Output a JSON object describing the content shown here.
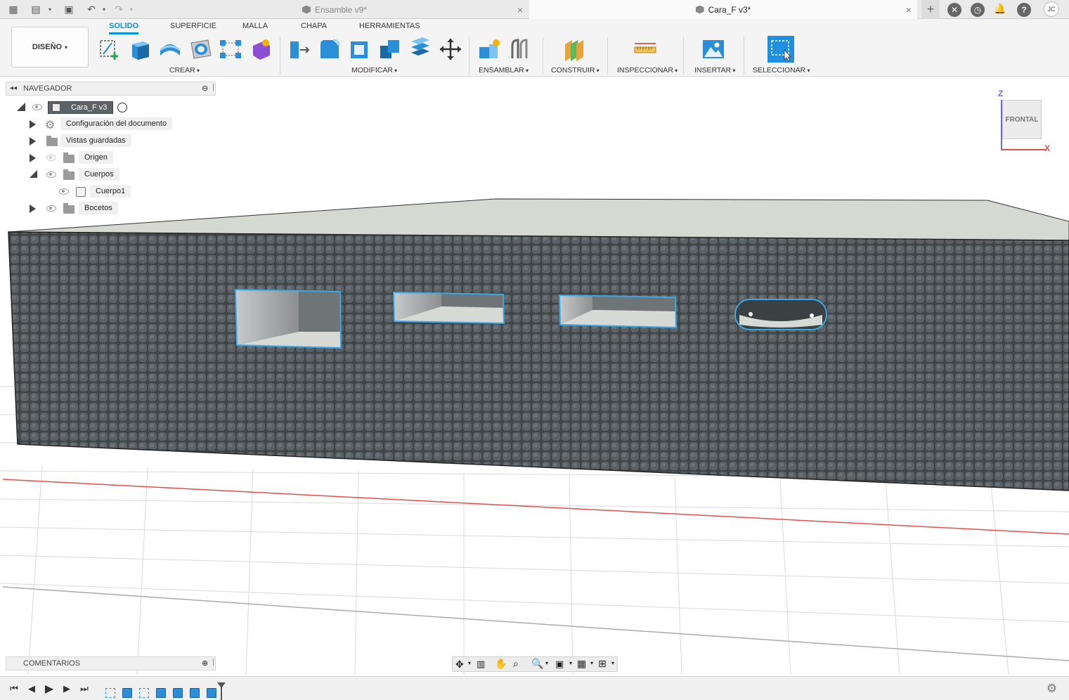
{
  "tabs": [
    {
      "label": "Ensamble v9*",
      "active": false
    },
    {
      "label": "Cara_F v3*",
      "active": true
    }
  ],
  "user_initials": "JC",
  "workspace": "DISEÑO",
  "ribbon_tabs": [
    "SOLIDO",
    "SUPERFICIE",
    "MALLA",
    "CHAPA",
    "HERRAMIENTAS"
  ],
  "groups": {
    "crear": "CREAR",
    "modificar": "MODIFICAR",
    "ensamblar": "ENSAMBLAR",
    "construir": "CONSTRUIR",
    "inspeccionar": "INSPECCIONAR",
    "insertar": "INSERTAR",
    "seleccionar": "SELECCIONAR"
  },
  "navigator": {
    "title": "NAVEGADOR",
    "root": "Cara_F v3",
    "items": [
      {
        "label": "Configuración del documento"
      },
      {
        "label": "Vistas guardadas"
      },
      {
        "label": "Origen"
      },
      {
        "label": "Cuerpos"
      },
      {
        "label": "Cuerpo1"
      },
      {
        "label": "Bocetos"
      }
    ]
  },
  "viewcube": {
    "face": "FRONTAL",
    "axis_z": "Z",
    "axis_x": "X"
  },
  "comments": {
    "title": "COMENTARIOS"
  },
  "colors": {
    "accent": "#0696d7",
    "wall": "#4b5052",
    "top_face": "#d6d8d2",
    "grid_red": "#e05050"
  }
}
